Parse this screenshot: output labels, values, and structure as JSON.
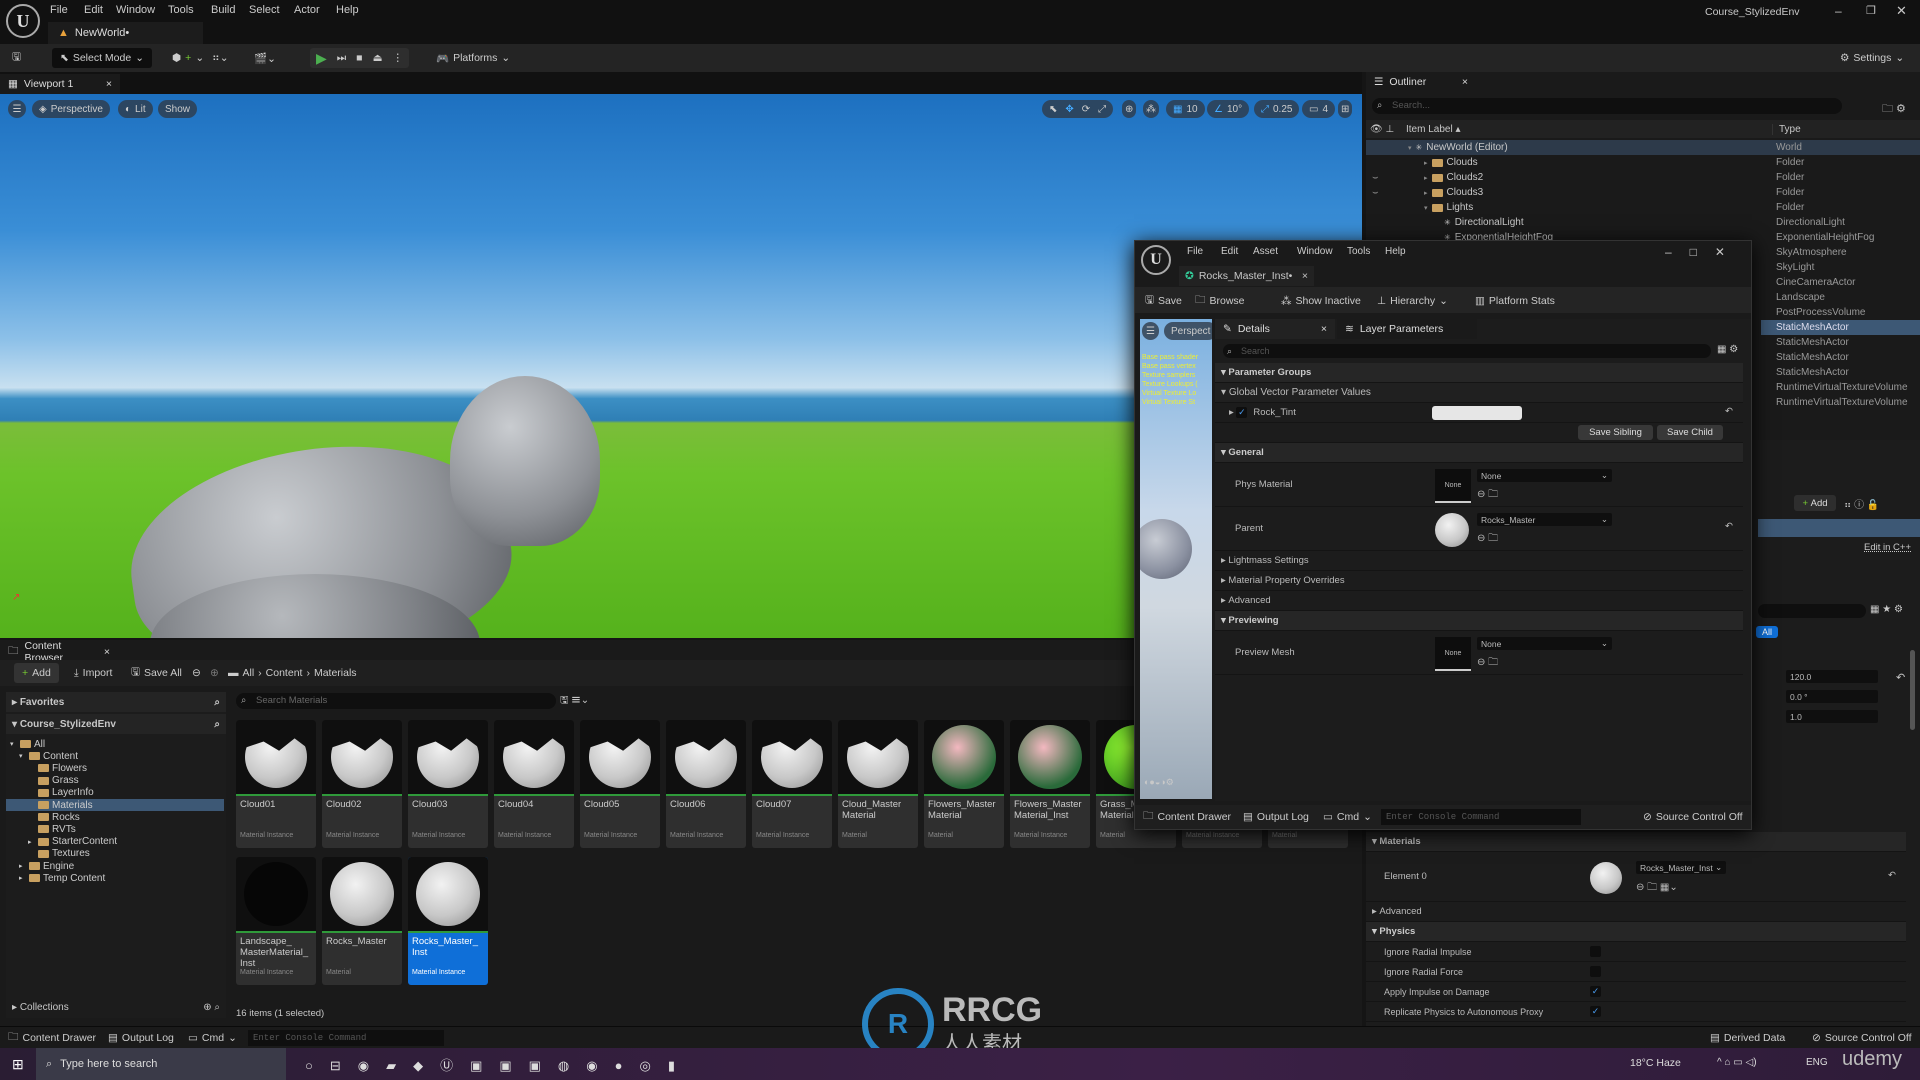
{
  "app": {
    "project_title": "Course_StylizedEnv",
    "menu": [
      "File",
      "Edit",
      "Window",
      "Tools",
      "Build",
      "Select",
      "Actor",
      "Help"
    ],
    "doc_tab": "NewWorld•",
    "toolbar": {
      "select_mode": "Select Mode",
      "platforms": "Platforms",
      "settings": "Settings"
    }
  },
  "viewport": {
    "tab": "Viewport 1",
    "perspective": "Perspective",
    "lit": "Lit",
    "show": "Show",
    "grid_snap": "10",
    "rotation_snap": "10°",
    "scale_snap": "0.25",
    "camera_speed": "4"
  },
  "content_browser": {
    "tab": "Content Browser",
    "add": "Add",
    "import": "Import",
    "save_all": "Save All",
    "breadcrumb": [
      "All",
      "Content",
      "Materials"
    ],
    "favorites": "Favorites",
    "project": "Course_StylizedEnv",
    "search_placeholder": "Search Materials",
    "tree": [
      {
        "label": "All",
        "depth": 0,
        "open": true
      },
      {
        "label": "Content",
        "depth": 1,
        "open": true
      },
      {
        "label": "Flowers",
        "depth": 2
      },
      {
        "label": "Grass",
        "depth": 2
      },
      {
        "label": "LayerInfo",
        "depth": 2
      },
      {
        "label": "Materials",
        "depth": 2,
        "selected": true
      },
      {
        "label": "Rocks",
        "depth": 2
      },
      {
        "label": "RVTs",
        "depth": 2
      },
      {
        "label": "StarterContent",
        "depth": 2,
        "arrow": true
      },
      {
        "label": "Textures",
        "depth": 2
      },
      {
        "label": "Engine",
        "depth": 1,
        "arrow": true
      },
      {
        "label": "Temp Content",
        "depth": 1,
        "arrow": true
      }
    ],
    "assets": [
      {
        "name": "Cloud01",
        "type": "Material Instance",
        "thumb": "cloud"
      },
      {
        "name": "Cloud02",
        "type": "Material Instance",
        "thumb": "cloud"
      },
      {
        "name": "Cloud03",
        "type": "Material Instance",
        "thumb": "cloud"
      },
      {
        "name": "Cloud04",
        "type": "Material Instance",
        "thumb": "cloud"
      },
      {
        "name": "Cloud05",
        "type": "Material Instance",
        "thumb": "cloud"
      },
      {
        "name": "Cloud06",
        "type": "Material Instance",
        "thumb": "cloud"
      },
      {
        "name": "Cloud07",
        "type": "Material Instance",
        "thumb": "cloud"
      },
      {
        "name": "Cloud_Master Material",
        "type": "Material",
        "thumb": "cloud"
      },
      {
        "name": "Flowers_Master Material",
        "type": "Material",
        "thumb": "flower"
      },
      {
        "name": "Flowers_Master Material_Inst",
        "type": "Material Instance",
        "thumb": "flower"
      },
      {
        "name": "Grass_Master Material",
        "type": "Material",
        "thumb": "grass"
      },
      {
        "name": "",
        "type": "Material Instance",
        "thumb": "none"
      },
      {
        "name": "",
        "type": "Material",
        "thumb": "none"
      },
      {
        "name": "Landscape_ MasterMaterial_ Inst",
        "type": "Material Instance",
        "thumb": "dark"
      },
      {
        "name": "Rocks_Master",
        "type": "Material",
        "thumb": "rock"
      },
      {
        "name": "Rocks_Master_ Inst",
        "type": "Material Instance",
        "thumb": "rock",
        "selected": true
      }
    ],
    "collections": "Collections",
    "status": "16 items (1 selected)"
  },
  "outliner": {
    "tab": "Outliner",
    "search_placeholder": "Search...",
    "col_label": "Item Label",
    "col_type": "Type",
    "rows": [
      {
        "label": "NewWorld (Editor)",
        "type": "World",
        "depth": 0,
        "selected": true
      },
      {
        "label": "Clouds",
        "type": "Folder",
        "depth": 1,
        "folder": true
      },
      {
        "label": "Clouds2",
        "type": "Folder",
        "depth": 1,
        "folder": true,
        "hidden": true
      },
      {
        "label": "Clouds3",
        "type": "Folder",
        "depth": 1,
        "folder": true,
        "hidden": true
      },
      {
        "label": "Lights",
        "type": "Folder",
        "depth": 1,
        "folder": true
      },
      {
        "label": "DirectionalLight",
        "type": "DirectionalLight",
        "depth": 2
      },
      {
        "label": "ExponentialHeightFog",
        "type": "ExponentialHeightFog",
        "depth": 2
      },
      {
        "label": "",
        "type": "SkyAtmosphere"
      },
      {
        "label": "",
        "type": "SkyLight"
      },
      {
        "label": "",
        "type": "CineCameraActor"
      },
      {
        "label": "",
        "type": "Landscape"
      },
      {
        "label": "",
        "type": "PostProcessVolume"
      },
      {
        "label": "",
        "type": "StaticMeshActor",
        "selected": true
      },
      {
        "label": "",
        "type": "StaticMeshActor"
      },
      {
        "label": "",
        "type": "StaticMeshActor"
      },
      {
        "label": "",
        "type": "StaticMeshActor"
      },
      {
        "label": "",
        "type": "RuntimeVirtualTextureVolume"
      },
      {
        "label": "",
        "type": "RuntimeVirtualTextureVolume"
      }
    ]
  },
  "actor_details": {
    "add": "Add",
    "edit_cpp": "Edit in C++",
    "filter_all": "All",
    "values": [
      "120.0",
      "0.0 °",
      "1.0"
    ],
    "materials_header": "Materials",
    "element0": "Element 0",
    "element0_value": "Rocks_Master_Inst",
    "advanced": "Advanced",
    "physics_header": "Physics",
    "physics": [
      {
        "label": "Ignore Radial Impulse",
        "checked": false
      },
      {
        "label": "Ignore Radial Force",
        "checked": false
      },
      {
        "label": "Apply Impulse on Damage",
        "checked": true
      },
      {
        "label": "Replicate Physics to Autonomous Proxy",
        "checked": true
      }
    ]
  },
  "material_editor": {
    "menu": [
      "File",
      "Edit",
      "Asset",
      "Window",
      "Tools",
      "Help"
    ],
    "tab": "Rocks_Master_Inst•",
    "toolbar": [
      "Save",
      "Browse",
      "Show Inactive",
      "Hierarchy",
      "Platform Stats"
    ],
    "preview_tab": "Perspect",
    "stats_lines": [
      "Base pass shader",
      "Base pass vertex",
      "Texture samplers",
      "Texture Lookups (",
      "Virtual Texture Lo",
      "Virtual Texture St"
    ],
    "details_tab": "Details",
    "layer_tab": "Layer Parameters",
    "search_placeholder": "Search",
    "parameter_groups": "Parameter Groups",
    "global_vector": "Global Vector Parameter Values",
    "rock_tint": "Rock_Tint",
    "rock_tint_color": "#e6e6e6",
    "save_sibling": "Save Sibling",
    "save_child": "Save Child",
    "general": "General",
    "phys_material": "Phys Material",
    "none": "None",
    "parent": "Parent",
    "parent_value": "Rocks_Master",
    "lightmass": "Lightmass Settings",
    "overrides": "Material Property Overrides",
    "advanced": "Advanced",
    "previewing": "Previewing",
    "preview_mesh": "Preview Mesh",
    "bottom": {
      "content_drawer": "Content Drawer",
      "output_log": "Output Log",
      "cmd": "Cmd",
      "console_placeholder": "Enter Console Command",
      "source_control": "Source Control Off"
    }
  },
  "status_bar": {
    "content_drawer": "Content Drawer",
    "output_log": "Output Log",
    "cmd": "Cmd",
    "console_placeholder": "Enter Console Command",
    "derived_data": "Derived Data",
    "source_control": "Source Control Off"
  },
  "taskbar": {
    "search_placeholder": "Type here to search",
    "weather": "18°C  Haze",
    "lang": "ENG"
  },
  "watermark": {
    "brand": "RRCG",
    "sub": "人人素材",
    "udemy": "udemy"
  },
  "colors": {
    "accent": "#0f6fd8",
    "selection": "#3d5875",
    "play": "#4caf50"
  }
}
